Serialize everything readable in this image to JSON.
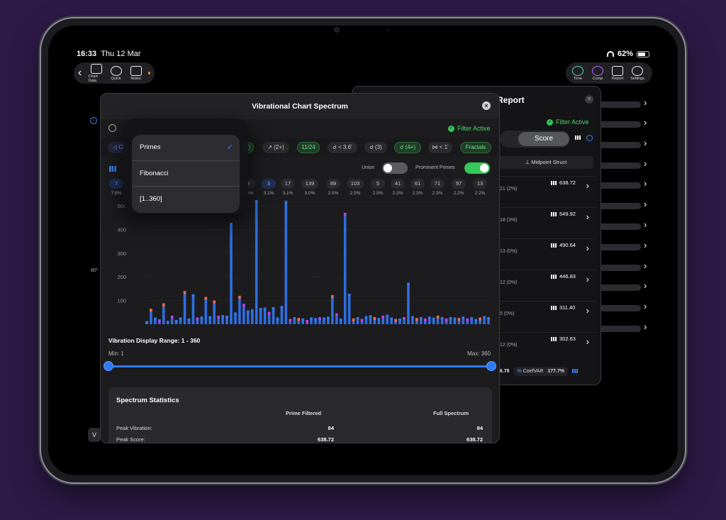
{
  "status": {
    "time": "16:33",
    "date": "Thu 12 Mar",
    "battery": "62%"
  },
  "toolbar_left": {
    "items": [
      "Chart Data",
      "Quick",
      "Notes"
    ]
  },
  "toolbar_right": {
    "items": [
      "Time",
      "Comp",
      "Report",
      "Settings"
    ]
  },
  "left_sidebar": {
    "degree_label": "80°",
    "button_label": "V"
  },
  "report": {
    "title": "Report",
    "filter_status": "Filter Active",
    "tab_left_partial": "s",
    "tab_selected": "Score",
    "sort_label": "Midpoint Struct",
    "rows": [
      {
        "sub": "21 (2%)",
        "value": "638.72"
      },
      {
        "sub": "18 (3%)",
        "value": "549.92"
      },
      {
        "sub": "13 (0%)",
        "value": "490.64"
      },
      {
        "sub": "12 (0%)",
        "value": "446.83"
      },
      {
        "sub": "5 (0%)",
        "value": "311.40"
      },
      {
        "sub": "12 (0%)",
        "value": "302.63"
      }
    ],
    "footer": {
      "left_value": "96.78",
      "coef_label": "CoefVAR",
      "coef_value": "177.7%"
    }
  },
  "modal": {
    "title": "Vibrational Chart Spectrum",
    "filter_status": "Filter Active",
    "chips": [
      {
        "label": "◁ Ci",
        "style": "blue"
      },
      {
        "label": "◯",
        "style": "green"
      },
      {
        "label": "↗ (2+)",
        "style": "plain"
      },
      {
        "label": "11/24",
        "style": "green"
      },
      {
        "label": "☌ < 3.6'",
        "style": "plain"
      },
      {
        "label": "☌ (3)",
        "style": "plain"
      },
      {
        "label": "☌ (4+)",
        "style": "green"
      },
      {
        "label": "⋈ < 1'",
        "style": "plain"
      },
      {
        "label": "Fractals",
        "style": "green"
      }
    ],
    "union_label": "Union",
    "prominent_label": "Prominent Primes",
    "vibrations": [
      {
        "n": "7",
        "p": "7.8%"
      },
      {
        "n": "9",
        "p": "3.5%"
      },
      {
        "n": "3",
        "p": "3.1%"
      },
      {
        "n": "17",
        "p": "3.1%"
      },
      {
        "n": "139",
        "p": "3.0%"
      },
      {
        "n": "89",
        "p": "2.5%"
      },
      {
        "n": "103",
        "p": "2.5%"
      },
      {
        "n": "5",
        "p": "2.5%"
      },
      {
        "n": "41",
        "p": "2.3%"
      },
      {
        "n": "61",
        "p": "2.3%"
      },
      {
        "n": "71",
        "p": "2.3%"
      },
      {
        "n": "97",
        "p": "2.2%"
      },
      {
        "n": "13",
        "p": "2.2%"
      }
    ],
    "range": {
      "title": "Vibration Display Range: 1 - 360",
      "min_label": "Min: 1",
      "max_label": "Max: 360",
      "min": 1,
      "max": 360
    },
    "stats": {
      "title": "Spectrum Statistics",
      "col1": "Prime Filtered",
      "col2": "Full Spectrum",
      "rows": [
        {
          "label": "Peak Vibration:",
          "v1": "84",
          "v2": "84"
        },
        {
          "label": "Peak Score:",
          "v1": "638.72",
          "v2": "638.72"
        }
      ]
    }
  },
  "popup": {
    "items": [
      "Primes",
      "Fibonacci",
      "[1..360]"
    ],
    "selected": "Primes"
  },
  "chart_data": {
    "type": "bar",
    "ylim": [
      0,
      500
    ],
    "yticks": [
      100,
      200,
      300,
      400,
      500
    ],
    "bars": [
      {
        "v": 13,
        "top": "#2f7bf5"
      },
      {
        "v": 65,
        "top": "#ff6b3a"
      },
      {
        "v": 28,
        "top": "#2f7bf5"
      },
      {
        "v": 20,
        "top": "#c83cf0"
      },
      {
        "v": 88,
        "top": "#ff6b3a"
      },
      {
        "v": 14,
        "top": "#2f7bf5"
      },
      {
        "v": 36,
        "top": "#c83cf0"
      },
      {
        "v": 18,
        "top": "#2f7bf5"
      },
      {
        "v": 28,
        "top": "#2f7bf5"
      },
      {
        "v": 140,
        "top": "#ff6b3a"
      },
      {
        "v": 24,
        "top": "#2f7bf5"
      },
      {
        "v": 126,
        "top": "#2f7bf5"
      },
      {
        "v": 28,
        "top": "#c83cf0"
      },
      {
        "v": 32,
        "top": "#2f7bf5"
      },
      {
        "v": 115,
        "top": "#ff6b3a"
      },
      {
        "v": 34,
        "top": "#2f7bf5"
      },
      {
        "v": 100,
        "top": "#ff6b3a"
      },
      {
        "v": 36,
        "top": "#c83cf0"
      },
      {
        "v": 38,
        "top": "#2f7bf5"
      },
      {
        "v": 36,
        "top": "#2f7bf5"
      },
      {
        "v": 428,
        "top": "#2f7bf5"
      },
      {
        "v": 49,
        "top": "#2f7bf5"
      },
      {
        "v": 120,
        "top": "#ff6b3a"
      },
      {
        "v": 86,
        "top": "#c83cf0"
      },
      {
        "v": 58,
        "top": "#2f7bf5"
      },
      {
        "v": 62,
        "top": "#2f7bf5"
      },
      {
        "v": 620,
        "top": "#2f7bf5"
      },
      {
        "v": 68,
        "top": "#2f7bf5"
      },
      {
        "v": 70,
        "top": "#2f7bf5"
      },
      {
        "v": 52,
        "top": "#c83cf0"
      },
      {
        "v": 72,
        "top": "#2f7bf5"
      },
      {
        "v": 28,
        "top": "#2f7bf5"
      },
      {
        "v": 77,
        "top": "#2f7bf5"
      },
      {
        "v": 520,
        "top": "#2f7bf5"
      },
      {
        "v": 22,
        "top": "#c83cf0"
      },
      {
        "v": 30,
        "top": "#2f7bf5"
      },
      {
        "v": 26,
        "top": "#ff6b3a"
      },
      {
        "v": 24,
        "top": "#2f7bf5"
      },
      {
        "v": 18,
        "top": "#c83cf0"
      },
      {
        "v": 28,
        "top": "#2f7bf5"
      },
      {
        "v": 26,
        "top": "#2f7bf5"
      },
      {
        "v": 30,
        "top": "#c83cf0"
      },
      {
        "v": 28,
        "top": "#2f7bf5"
      },
      {
        "v": 32,
        "top": "#2f7bf5"
      },
      {
        "v": 123,
        "top": "#ff6b3a"
      },
      {
        "v": 46,
        "top": "#c83cf0"
      },
      {
        "v": 24,
        "top": "#2f7bf5"
      },
      {
        "v": 470,
        "top": "#c83cf0"
      },
      {
        "v": 129,
        "top": "#2f7bf5"
      },
      {
        "v": 24,
        "top": "#ff6b3a"
      },
      {
        "v": 30,
        "top": "#2f7bf5"
      },
      {
        "v": 22,
        "top": "#c83cf0"
      },
      {
        "v": 34,
        "top": "#2f7bf5"
      },
      {
        "v": 38,
        "top": "#2f7bf5"
      },
      {
        "v": 30,
        "top": "#ff6b3a"
      },
      {
        "v": 26,
        "top": "#2f7bf5"
      },
      {
        "v": 36,
        "top": "#c83cf0"
      },
      {
        "v": 40,
        "top": "#2f7bf5"
      },
      {
        "v": 28,
        "top": "#2f7bf5"
      },
      {
        "v": 22,
        "top": "#ff6b3a"
      },
      {
        "v": 24,
        "top": "#2f7bf5"
      },
      {
        "v": 30,
        "top": "#c83cf0"
      },
      {
        "v": 175,
        "top": "#2f7bf5"
      },
      {
        "v": 34,
        "top": "#2f7bf5"
      },
      {
        "v": 26,
        "top": "#ff6b3a"
      },
      {
        "v": 30,
        "top": "#2f7bf5"
      },
      {
        "v": 24,
        "top": "#c83cf0"
      },
      {
        "v": 32,
        "top": "#2f7bf5"
      },
      {
        "v": 28,
        "top": "#2f7bf5"
      },
      {
        "v": 36,
        "top": "#ff6b3a"
      },
      {
        "v": 30,
        "top": "#2f7bf5"
      },
      {
        "v": 24,
        "top": "#c83cf0"
      },
      {
        "v": 30,
        "top": "#2f7bf5"
      },
      {
        "v": 28,
        "top": "#2f7bf5"
      },
      {
        "v": 26,
        "top": "#ff6b3a"
      },
      {
        "v": 32,
        "top": "#2f7bf5"
      },
      {
        "v": 24,
        "top": "#c83cf0"
      },
      {
        "v": 30,
        "top": "#2f7bf5"
      },
      {
        "v": 22,
        "top": "#2f7bf5"
      },
      {
        "v": 28,
        "top": "#ff6b3a"
      },
      {
        "v": 34,
        "top": "#2f7bf5"
      },
      {
        "v": 30,
        "top": "#2f7bf5"
      }
    ]
  }
}
